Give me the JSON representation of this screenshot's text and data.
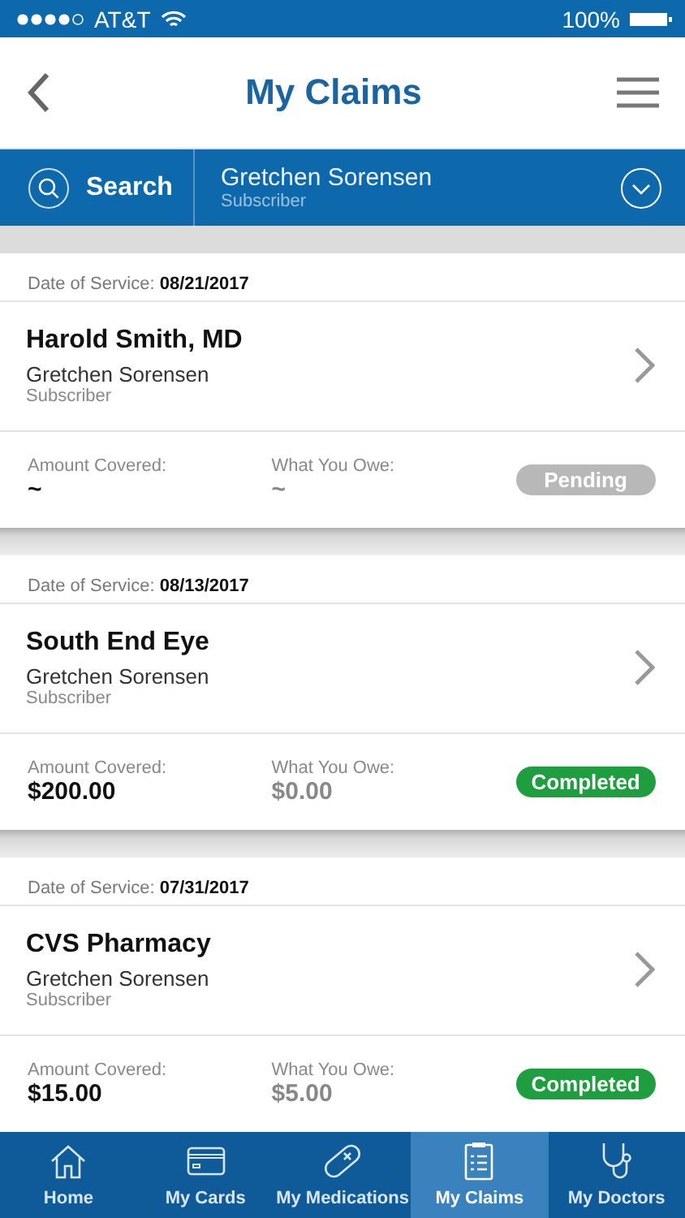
{
  "status_bar": {
    "carrier": "AT&T",
    "battery": "100%"
  },
  "header": {
    "title": "My Claims"
  },
  "filter": {
    "search_label": "Search",
    "member_name": "Gretchen Sorensen",
    "member_role": "Subscriber"
  },
  "claims": [
    {
      "date_label": "Date of Service:",
      "date": "08/21/2017",
      "provider": "Harold Smith, MD",
      "member_name": "Gretchen Sorensen",
      "member_role": "Subscriber",
      "covered_label": "Amount Covered:",
      "covered": "~",
      "owe_label": "What You Owe:",
      "owe": "~",
      "status": "Pending",
      "kind": "pending"
    },
    {
      "date_label": "Date of Service:",
      "date": "08/13/2017",
      "provider": "South End Eye",
      "member_name": "Gretchen Sorensen",
      "member_role": "Subscriber",
      "covered_label": "Amount Covered:",
      "covered": "$200.00",
      "owe_label": "What You Owe:",
      "owe": "$0.00",
      "status": "Completed",
      "kind": "completed"
    },
    {
      "date_label": "Date of Service:",
      "date": "07/31/2017",
      "provider": "CVS Pharmacy",
      "member_name": "Gretchen Sorensen",
      "member_role": "Subscriber",
      "covered_label": "Amount Covered:",
      "covered": "$15.00",
      "owe_label": "What You Owe:",
      "owe": "$5.00",
      "status": "Completed",
      "kind": "completed"
    }
  ],
  "tab_bar": [
    {
      "label": "Home",
      "kind": "home",
      "selected": false
    },
    {
      "label": "My Cards",
      "kind": "cards",
      "selected": false
    },
    {
      "label": "My Medications",
      "kind": "medications",
      "selected": false
    },
    {
      "label": "My Claims",
      "kind": "claims",
      "selected": true
    },
    {
      "label": "My Doctors",
      "kind": "doctors",
      "selected": false
    }
  ]
}
